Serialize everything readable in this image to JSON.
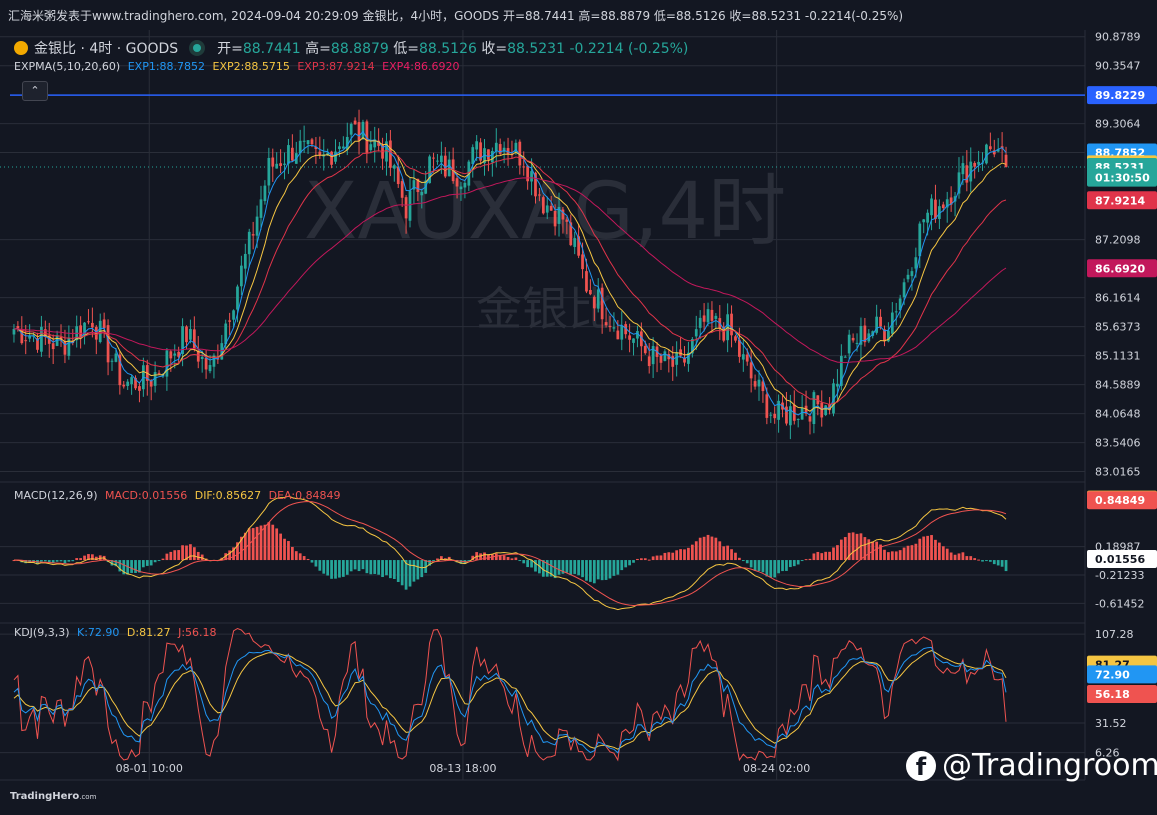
{
  "top_bar": {
    "text": "汇海米粥发表于www.tradinghero.com, 2024-09-04 20:29:09 金银比，4小时，GOODS 开=88.7441 高=88.8879 低=88.5126 收=88.5231 -0.2214(-0.25%)"
  },
  "header": {
    "symbol": "金银比 · 4时 · GOODS",
    "open_label": "开=",
    "open": "88.7441",
    "high_label": "高=",
    "high": "88.8879",
    "low_label": "低=",
    "low": "88.5126",
    "close_label": "收=",
    "close": "88.5231",
    "change": "-0.2214 (-0.25%)"
  },
  "expma": {
    "label": "EXPMA(5,10,20,60)",
    "exp1": "EXP1:88.7852",
    "exp2": "EXP2:88.5715",
    "exp3": "EXP3:87.9214",
    "exp4": "EXP4:86.6920"
  },
  "macd_header": {
    "label": "MACD(12,26,9)",
    "macd": "MACD:0.01556",
    "dif": "DIF:0.85627",
    "dea": "DEA:0.84849"
  },
  "kdj_header": {
    "label": "KDJ(9,3,3)",
    "k": "K:72.90",
    "d": "D:81.27",
    "j": "J:56.18"
  },
  "watermark": {
    "line1": "XAUXAG,4时",
    "line2": "金银比"
  },
  "footer": {
    "brand": "TradingHero",
    "suffix": ".com"
  },
  "social": {
    "icon": "facebook-icon",
    "handle": "@Tradingroom"
  },
  "colors": {
    "up": "#26a69a",
    "down": "#ef5350",
    "exp1": "#2196f3",
    "exp2": "#f5c542",
    "exp3": "#e0344a",
    "exp4": "#c2185b",
    "hline": "#2962ff"
  },
  "chart_data": [
    {
      "type": "candlestick",
      "title": "金银比 · 4时 · GOODS",
      "x_ticks": [
        "08-01 10:00",
        "08-13 18:00",
        "08-24 02:00"
      ],
      "y_ticks": [
        "90.8789",
        "90.3547",
        "89.3064",
        "88.7852",
        "87.2098",
        "86.1614",
        "85.6373",
        "85.1131",
        "84.5889",
        "84.0648",
        "83.5406",
        "83.0165"
      ],
      "ylim": [
        82.9,
        91.0
      ],
      "horizontal_line": 89.8229,
      "price_tags": [
        {
          "label": "89.8229",
          "value": 89.8229,
          "color": "#2962ff"
        },
        {
          "label": "88.7852",
          "value": 88.7852,
          "color": "#2196f3"
        },
        {
          "label": "88.5715",
          "value": 88.5715,
          "color": "#f5c542"
        },
        {
          "label": "88.5231",
          "value": 88.5231,
          "color": "#26a69a"
        },
        {
          "label": "01:30:50",
          "value": 88.33,
          "color": "#26a69a"
        },
        {
          "label": "87.9214",
          "value": 87.9214,
          "color": "#e0344a"
        },
        {
          "label": "86.6920",
          "value": 86.692,
          "color": "#c2185b"
        }
      ],
      "close_path": [
        [
          0,
          85.6
        ],
        [
          12,
          85.3
        ],
        [
          20,
          85.8
        ],
        [
          28,
          84.6
        ],
        [
          35,
          84.7
        ],
        [
          44,
          85.5
        ],
        [
          50,
          84.8
        ],
        [
          60,
          87.1
        ],
        [
          65,
          88.5
        ],
        [
          72,
          88.9
        ],
        [
          78,
          88.6
        ],
        [
          86,
          89.2
        ],
        [
          94,
          88.9
        ],
        [
          100,
          87.8
        ],
        [
          106,
          88.6
        ],
        [
          114,
          88.4
        ],
        [
          118,
          88.8
        ],
        [
          124,
          89.0
        ],
        [
          130,
          88.7
        ],
        [
          135,
          87.9
        ],
        [
          140,
          87.6
        ],
        [
          146,
          86.4
        ],
        [
          152,
          85.8
        ],
        [
          158,
          85.4
        ],
        [
          164,
          85.0
        ],
        [
          170,
          84.9
        ],
        [
          176,
          85.7
        ],
        [
          182,
          85.6
        ],
        [
          188,
          84.7
        ],
        [
          194,
          84.0
        ],
        [
          198,
          84.1
        ],
        [
          204,
          84.2
        ],
        [
          208,
          84.3
        ],
        [
          212,
          85.2
        ],
        [
          218,
          85.6
        ],
        [
          222,
          85.6
        ],
        [
          226,
          86.2
        ],
        [
          232,
          87.6
        ],
        [
          238,
          88.0
        ],
        [
          244,
          88.6
        ],
        [
          250,
          88.9
        ],
        [
          253,
          88.52
        ]
      ],
      "n_candles": 254,
      "expma_series": [
        {
          "name": "EXP1",
          "period": 5,
          "color": "#2196f3"
        },
        {
          "name": "EXP2",
          "period": 10,
          "color": "#f5c542"
        },
        {
          "name": "EXP3",
          "period": 20,
          "color": "#e0344a"
        },
        {
          "name": "EXP4",
          "period": 60,
          "color": "#c2185b"
        }
      ]
    },
    {
      "type": "bar",
      "title": "MACD(12,26,9)",
      "y_ticks": [
        "0.18987",
        "-0.21233",
        "-0.61452"
      ],
      "ylim": [
        -0.85,
        1.05
      ],
      "price_tags": [
        {
          "label": "0.85627",
          "value": 0.85627,
          "color": "#f5c542"
        },
        {
          "label": "0.84849",
          "value": 0.84849,
          "color": "#ef5350"
        },
        {
          "label": "0.01556",
          "value": 0.01556,
          "color": "#ffffff"
        }
      ],
      "series": [
        {
          "name": "MACD",
          "values": []
        },
        {
          "name": "DIF",
          "values": []
        },
        {
          "name": "DEA",
          "values": []
        }
      ]
    },
    {
      "type": "line",
      "title": "KDJ(9,3,3)",
      "y_ticks": [
        "107.28",
        "31.52",
        "6.26"
      ],
      "ylim": [
        0,
        115
      ],
      "price_tags": [
        {
          "label": "81.27",
          "value": 81.27,
          "color": "#f5c542"
        },
        {
          "label": "72.90",
          "value": 72.9,
          "color": "#2196f3"
        },
        {
          "label": "56.18",
          "value": 56.18,
          "color": "#ef5350"
        }
      ],
      "series": [
        {
          "name": "K",
          "values": []
        },
        {
          "name": "D",
          "values": []
        },
        {
          "name": "J",
          "values": []
        }
      ]
    }
  ]
}
